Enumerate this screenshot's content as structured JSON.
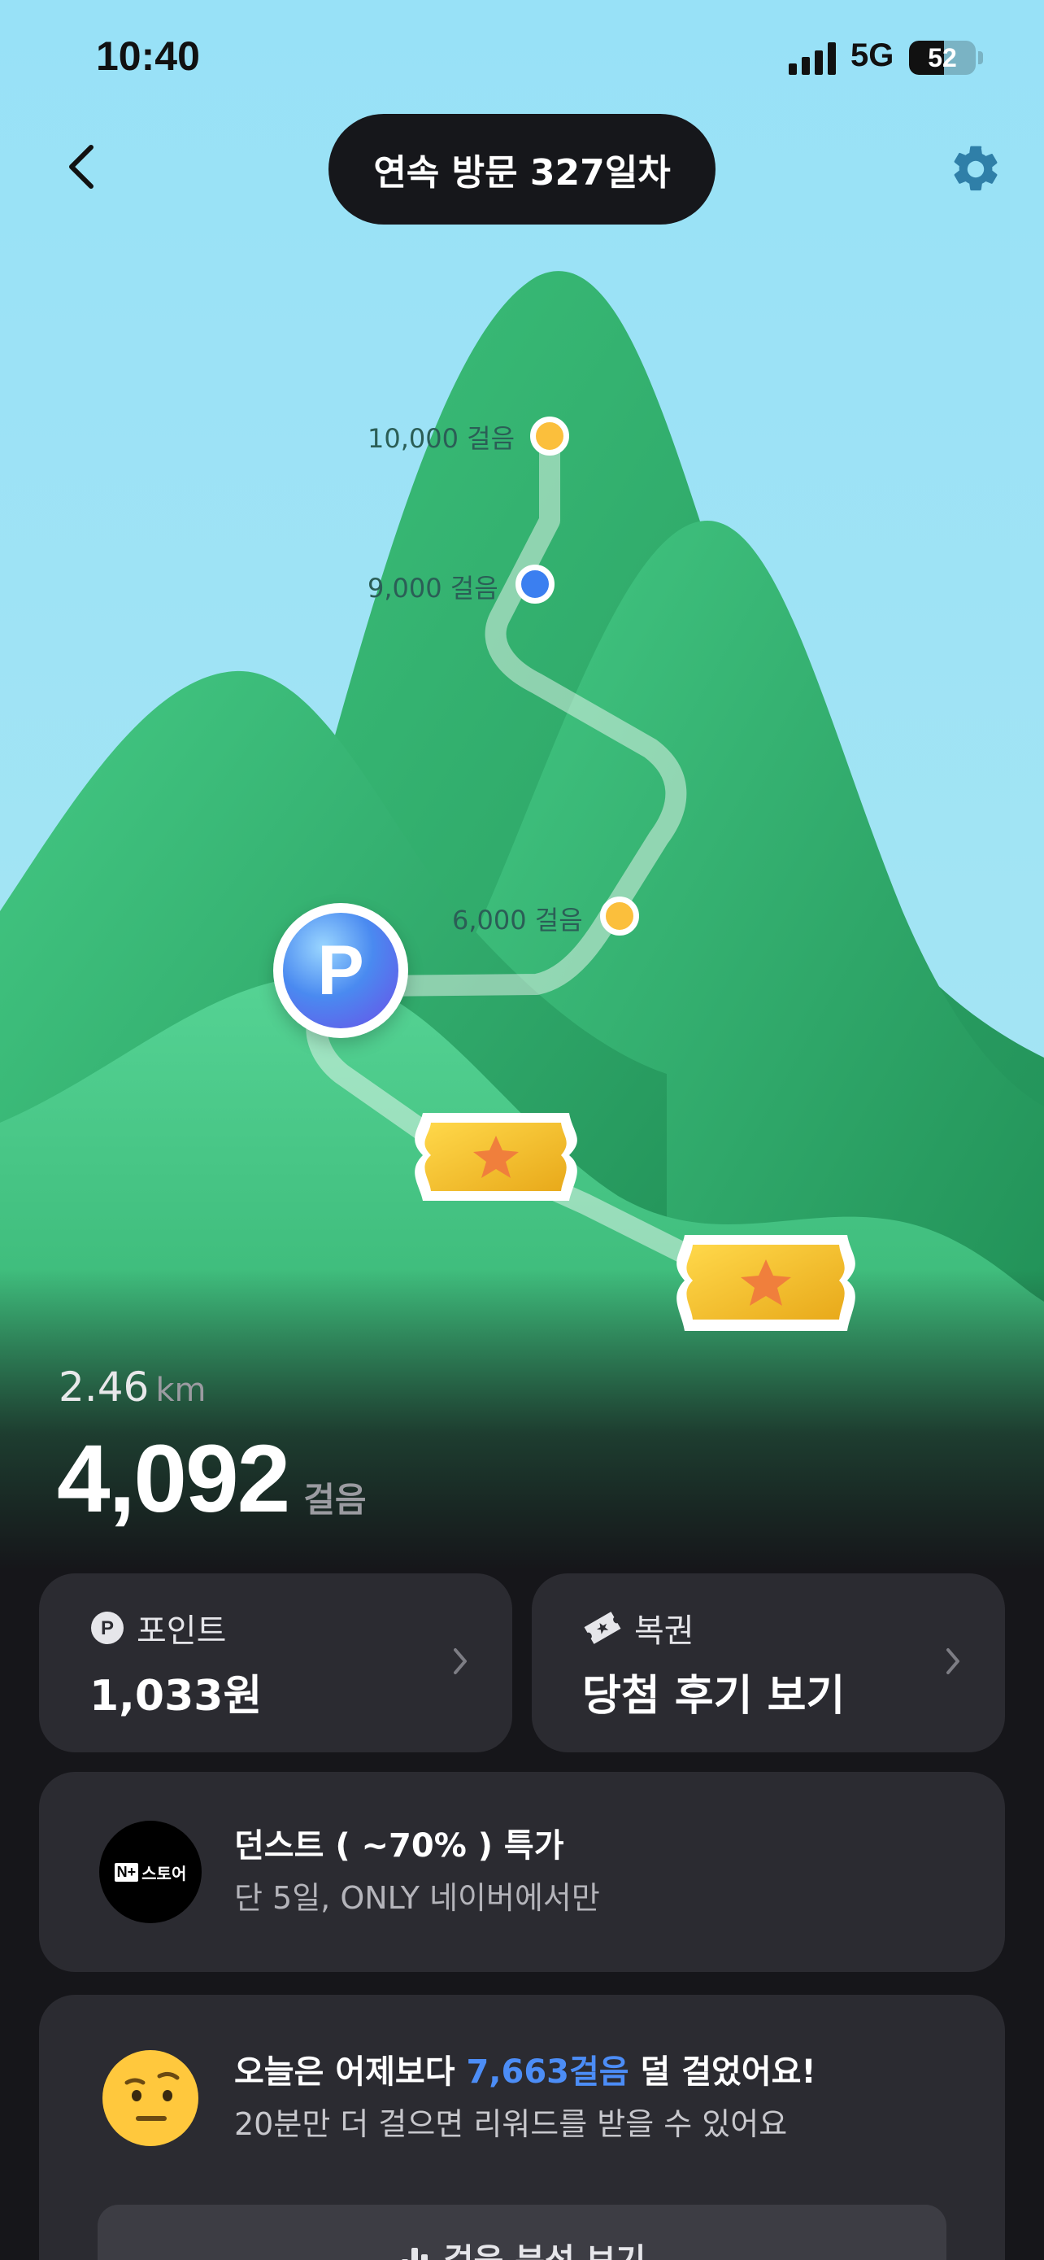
{
  "status_bar": {
    "time": "10:40",
    "network": "5G",
    "battery_percent": "52",
    "battery_level": 0.52
  },
  "header": {
    "back_icon": "chevron-left-icon",
    "visit_streak": "연속 방문 327일차",
    "settings_icon": "gear-icon"
  },
  "mountain": {
    "milestones": [
      {
        "label": "10,000 걸음",
        "color": "#fbbf3c"
      },
      {
        "label": "9,000 걸음",
        "color": "#3b7ff0"
      },
      {
        "label": "6,000 걸음",
        "color": "#fbbf3c"
      }
    ],
    "point_badge": "P",
    "ticket_icon": "ticket-star-icon"
  },
  "summary": {
    "distance": "2.46",
    "distance_unit": "km",
    "steps": "4,092",
    "steps_unit": "걸음"
  },
  "cards": {
    "points": {
      "label": "포인트",
      "icon": "point-p-icon",
      "value": "1,033원"
    },
    "lottery": {
      "label": "복권",
      "icon": "ticket-icon",
      "value": "당첨 후기 보기"
    }
  },
  "promo": {
    "logo_badge": "N+",
    "logo_text": "스토어",
    "title": "던스트 ( ~70% ) 특가",
    "subtitle": "단 5일, ONLY 네이버에서만"
  },
  "compare": {
    "title_prefix": "오늘은 어제보다 ",
    "title_highlight": "7,663걸음",
    "title_suffix": " 덜 걸었어요!",
    "subtitle": "20분만 더 걸으면 리워드를 받을 수 있어요",
    "button_label": "걸음 분석 보기"
  },
  "colors": {
    "sky": "#9de3f5",
    "mountain_green": "#2fb36a",
    "highlight_blue": "#4c8df6",
    "card_bg": "#2b2b31"
  }
}
